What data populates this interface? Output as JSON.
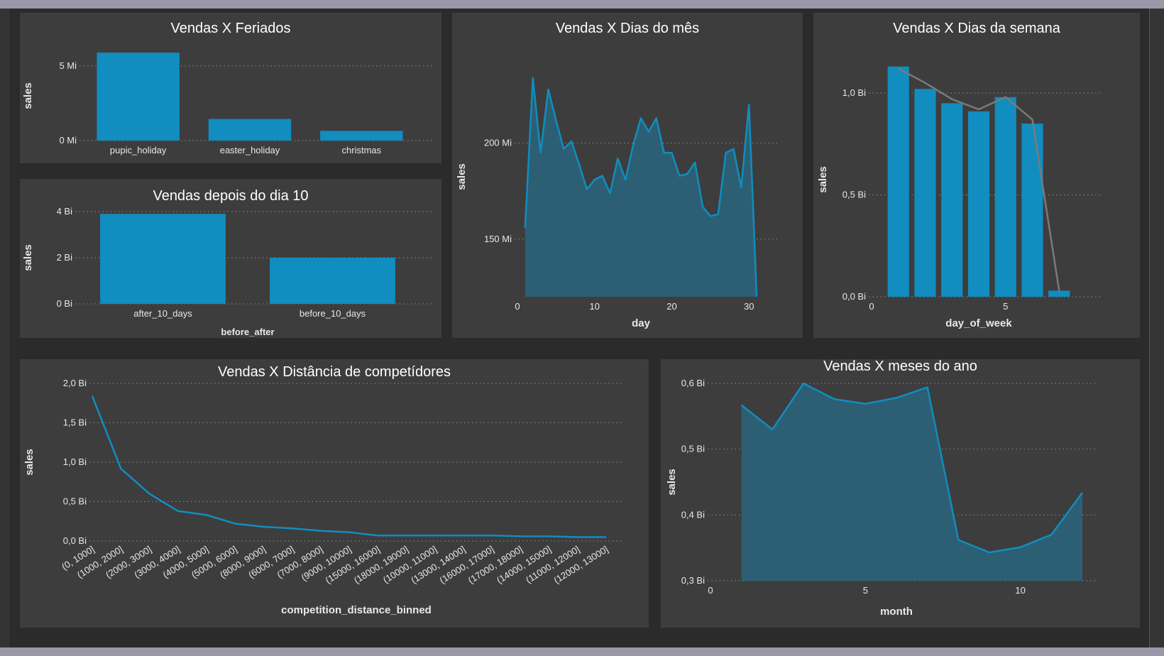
{
  "colors": {
    "bar": "#118dbf",
    "area_fill": "#2c5f73",
    "line": "#118dbf",
    "trend": "#7a7a7a"
  },
  "chart_data": [
    {
      "id": "feriados",
      "type": "bar",
      "title": "Vendas X Feriados",
      "xlabel": "",
      "ylabel": "sales",
      "categories": [
        "pupic_holiday",
        "easter_holiday",
        "christmas"
      ],
      "values": [
        5900000,
        1450000,
        650000
      ],
      "ylim": [
        0,
        6000000
      ],
      "yticks": [
        {
          "value": 0,
          "label": "0 Mi"
        },
        {
          "value": 5000000,
          "label": "5 Mi"
        }
      ],
      "grid": true
    },
    {
      "id": "depois10",
      "type": "bar",
      "title": "Vendas depois do dia 10",
      "xlabel": "before_after",
      "ylabel": "sales",
      "categories": [
        "after_10_days",
        "before_10_days"
      ],
      "values": [
        3900000000,
        2000000000
      ],
      "ylim": [
        0,
        4000000000
      ],
      "yticks": [
        {
          "value": 0,
          "label": "0 Bi"
        },
        {
          "value": 2000000000,
          "label": "2 Bi"
        },
        {
          "value": 4000000000,
          "label": "4 Bi"
        }
      ],
      "grid": true
    },
    {
      "id": "diasmes",
      "type": "area",
      "title": "Vendas X Dias do mês",
      "xlabel": "day",
      "ylabel": "sales",
      "x": [
        1,
        2,
        3,
        4,
        5,
        6,
        7,
        8,
        9,
        10,
        11,
        12,
        13,
        14,
        15,
        16,
        17,
        18,
        19,
        20,
        21,
        22,
        23,
        24,
        25,
        26,
        27,
        28,
        29,
        30,
        31
      ],
      "values": [
        156,
        234,
        195,
        228,
        212,
        197,
        201,
        189,
        176,
        181,
        183,
        174,
        192,
        181,
        199,
        213,
        206,
        213,
        195,
        195,
        183,
        184,
        190,
        167,
        162,
        163,
        195,
        197,
        177,
        220,
        120
      ],
      "values_unit": "Mi",
      "ylim": [
        120,
        245
      ],
      "xlim": [
        0,
        32
      ],
      "xticks": [
        0,
        10,
        20,
        30
      ],
      "yticks": [
        {
          "value": 150,
          "label": "150 Mi"
        },
        {
          "value": 200,
          "label": "200 Mi"
        }
      ],
      "grid": true
    },
    {
      "id": "diassemana",
      "type": "bar",
      "title": "Vendas X Dias da semana",
      "xlabel": "day_of_week",
      "ylabel": "sales",
      "x": [
        1,
        2,
        3,
        4,
        5,
        6,
        7
      ],
      "values": [
        1.13,
        1.02,
        0.95,
        0.91,
        0.98,
        0.85,
        0.03
      ],
      "trend": [
        1.12,
        1.05,
        0.97,
        0.92,
        0.98,
        0.87,
        0.03
      ],
      "values_unit": "Bi",
      "ylim": [
        0,
        1.15
      ],
      "xlim": [
        0,
        8
      ],
      "xticks": [
        0,
        5
      ],
      "yticks": [
        {
          "value": 0,
          "label": "0,0 Bi"
        },
        {
          "value": 0.5,
          "label": "0,5 Bi"
        },
        {
          "value": 1.0,
          "label": "1,0 Bi"
        }
      ],
      "grid": true
    },
    {
      "id": "distancia",
      "type": "line",
      "title": "Vendas X Distância de competídores",
      "xlabel": "competition_distance_binned",
      "ylabel": "sales",
      "categories": [
        "(0, 1000]",
        "(1000, 2000]",
        "(2000, 3000]",
        "(3000, 4000]",
        "(4000, 5000]",
        "(5000, 6000]",
        "(8000, 9000]",
        "(6000, 7000]",
        "(7000, 8000]",
        "(9000, 10000]",
        "(15000, 16000]",
        "(18000, 19000]",
        "(10000, 11000]",
        "(13000, 14000]",
        "(16000, 17000]",
        "(17000, 18000]",
        "(14000, 15000]",
        "(11000, 12000]",
        "(12000, 13000]"
      ],
      "values": [
        1.84,
        0.92,
        0.6,
        0.38,
        0.33,
        0.22,
        0.18,
        0.16,
        0.13,
        0.11,
        0.07,
        0.07,
        0.07,
        0.07,
        0.07,
        0.06,
        0.06,
        0.05,
        0.05
      ],
      "values_unit": "Bi",
      "ylim": [
        0,
        2.0
      ],
      "yticks": [
        {
          "value": 0,
          "label": "0,0 Bi"
        },
        {
          "value": 0.5,
          "label": "0,5 Bi"
        },
        {
          "value": 1.0,
          "label": "1,0 Bi"
        },
        {
          "value": 1.5,
          "label": "1,5 Bi"
        },
        {
          "value": 2.0,
          "label": "2,0 Bi"
        }
      ],
      "grid": true
    },
    {
      "id": "meses",
      "type": "area",
      "title": "Vendas X meses do ano",
      "xlabel": "month",
      "ylabel": "sales",
      "x": [
        1,
        2,
        3,
        4,
        5,
        6,
        7,
        8,
        9,
        10,
        11,
        12
      ],
      "values": [
        0.567,
        0.53,
        0.6,
        0.576,
        0.569,
        0.578,
        0.594,
        0.362,
        0.343,
        0.351,
        0.37,
        0.434
      ],
      "values_unit": "Bi",
      "ylim": [
        0.3,
        0.6
      ],
      "xlim": [
        0,
        12
      ],
      "xticks": [
        0,
        5,
        10
      ],
      "yticks": [
        {
          "value": 0.3,
          "label": "0,3 Bi"
        },
        {
          "value": 0.4,
          "label": "0,4 Bi"
        },
        {
          "value": 0.5,
          "label": "0,5 Bi"
        },
        {
          "value": 0.6,
          "label": "0,6 Bi"
        }
      ],
      "grid": true
    }
  ]
}
